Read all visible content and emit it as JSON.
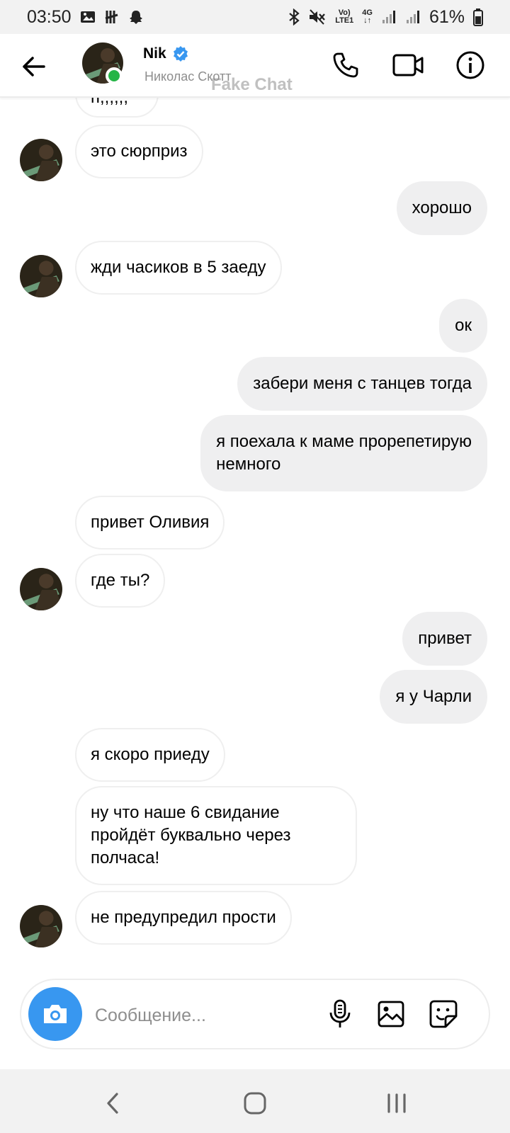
{
  "status_bar": {
    "time": "03:50",
    "battery": "61%",
    "network_top": "Vo)",
    "network_bottom": "LTE1",
    "gen": "4G",
    "icons": [
      "gallery-icon",
      "tally-icon",
      "ghost-icon",
      "bluetooth-icon",
      "mute-icon",
      "signal-icon",
      "battery-icon"
    ]
  },
  "header": {
    "name": "Nik",
    "subtitle": "Николас Скотт",
    "watermark": "Fake Chat",
    "status": "online",
    "accent": "#3897f0",
    "online_color": "#26b547"
  },
  "messages": [
    {
      "dir": "in",
      "text": "п,,,,,,"
    },
    {
      "dir": "in",
      "text": "это сюрприз"
    },
    {
      "dir": "out",
      "text": "хорошо"
    },
    {
      "dir": "in",
      "text": "жди часиков в 5 заеду"
    },
    {
      "dir": "out",
      "text": "ок"
    },
    {
      "dir": "out",
      "text": "забери меня с танцев тогда"
    },
    {
      "dir": "out",
      "text": "я поехала к маме прорепетирую\nнемного"
    },
    {
      "dir": "in",
      "text": "привет Оливия"
    },
    {
      "dir": "in",
      "text": "где ты?"
    },
    {
      "dir": "out",
      "text": "привет"
    },
    {
      "dir": "out",
      "text": "я у Чарли"
    },
    {
      "dir": "in",
      "text": "я скоро приеду"
    },
    {
      "dir": "in",
      "text": "ну что наше 6 свидание\nпройдёт буквально через\nполчаса!"
    },
    {
      "dir": "in",
      "text": "не предупредил прости"
    }
  ],
  "composer": {
    "placeholder": "Сообщение...",
    "icons": [
      "camera-icon",
      "microphone-icon",
      "image-icon",
      "sticker-icon"
    ]
  },
  "navbar": {
    "icons": [
      "back-nav-icon",
      "home-nav-icon",
      "recents-nav-icon"
    ]
  }
}
